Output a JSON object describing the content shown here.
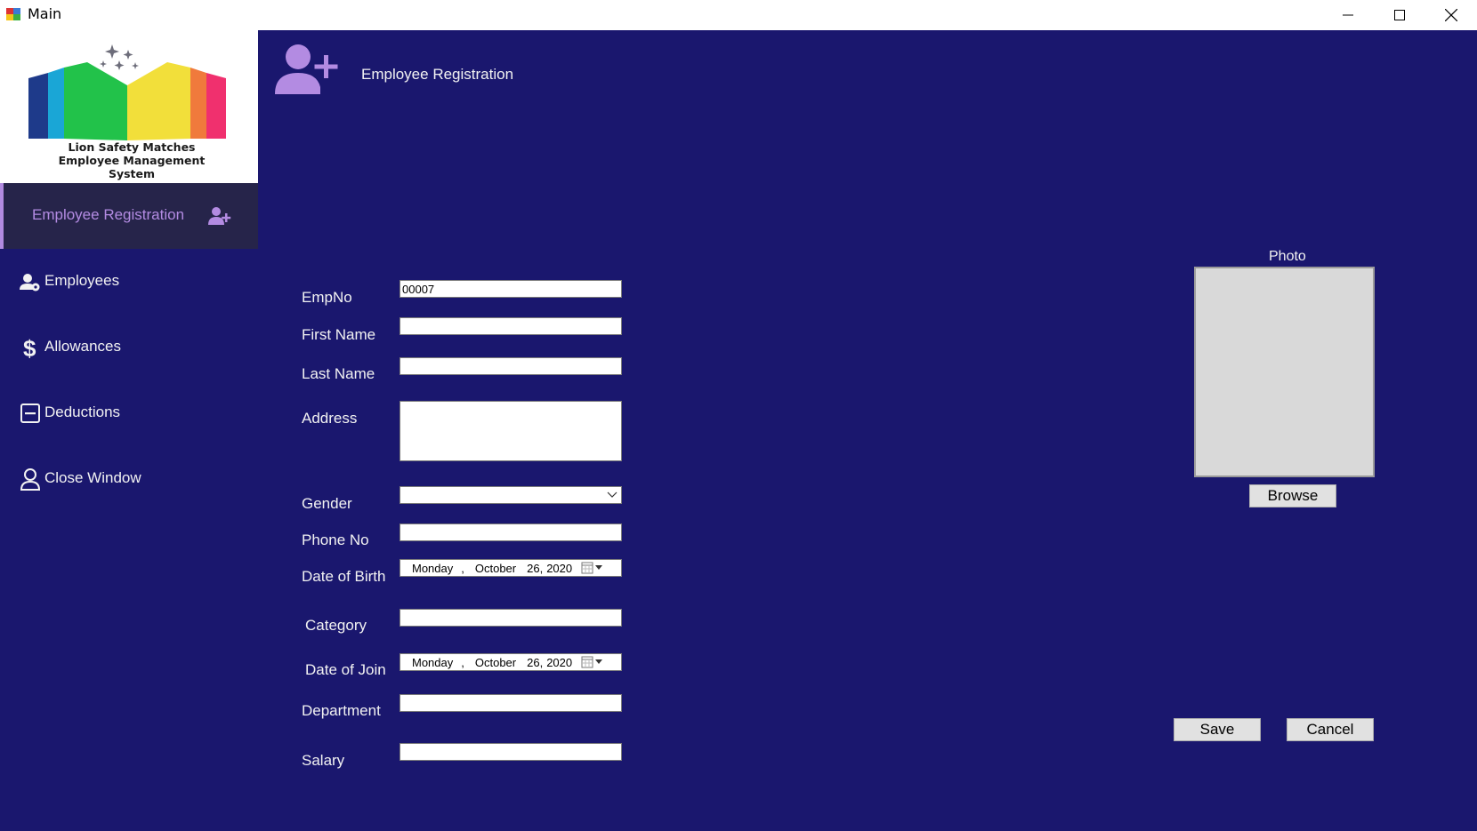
{
  "window": {
    "title": "Main"
  },
  "logo": {
    "line1": "Lion Safety Matches",
    "line2": "Employee Management",
    "line3": "System"
  },
  "sidebar": {
    "active": {
      "label": "Employee Registration",
      "icon": "user-plus-icon"
    },
    "items": [
      {
        "label": "Employees",
        "icon": "users-icon"
      },
      {
        "label": "Allowances",
        "icon": "dollar-icon"
      },
      {
        "label": "Deductions",
        "icon": "minus-square-icon"
      },
      {
        "label": "Close Window",
        "icon": "user-outline-icon"
      }
    ]
  },
  "header": {
    "title": "Employee Registration",
    "icon": "user-plus-icon"
  },
  "form": {
    "empno": {
      "label": "EmpNo",
      "value": "00007"
    },
    "first_name": {
      "label": "First Name",
      "value": ""
    },
    "last_name": {
      "label": "Last Name",
      "value": ""
    },
    "address": {
      "label": "Address",
      "value": ""
    },
    "gender": {
      "label": "Gender",
      "value": ""
    },
    "phone": {
      "label": "Phone No",
      "value": ""
    },
    "dob": {
      "label": "Date of Birth",
      "weekday": "Monday",
      "sep": ",",
      "month": "October",
      "day": "26,",
      "year": "2020"
    },
    "category": {
      "label": "Category",
      "value": ""
    },
    "doj": {
      "label": "Date of Join",
      "weekday": "Monday",
      "sep": ",",
      "month": "October",
      "day": "26,",
      "year": "2020"
    },
    "department": {
      "label": "Department",
      "value": ""
    },
    "salary": {
      "label": "Salary",
      "value": ""
    }
  },
  "photo": {
    "label": "Photo",
    "browse": "Browse"
  },
  "actions": {
    "save": "Save",
    "cancel": "Cancel"
  },
  "colors": {
    "background": "#1a176e",
    "accent": "#b18ae0",
    "active_bg": "#26244a"
  }
}
